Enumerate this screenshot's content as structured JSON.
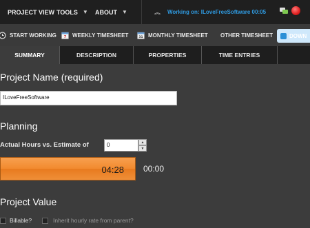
{
  "menu": {
    "items": [
      "PROJECT VIEW",
      "TOOLS",
      "ABOUT"
    ]
  },
  "working": {
    "label": "Working on: ILoveFreeSoftware 00:05"
  },
  "toolbar": {
    "start_working": "START WORKING",
    "weekly_timesheet": "WEEKLY TIMESHEET",
    "monthly_timesheet": "MONTHLY TIMESHEET",
    "other_timesheet": "OTHER TIMESHEET",
    "download": "DOWN"
  },
  "tabs": [
    "SUMMARY",
    "DESCRIPTION",
    "PROPERTIES",
    "TIME ENTRIES"
  ],
  "summary": {
    "project_name_heading": "Project Name (required)",
    "project_name_value": "ILoveFreeSoftware",
    "planning_heading": "Planning",
    "estimate_label": "Actual Hours vs. Estimate of",
    "estimate_value": "0",
    "progress_time": "04:28",
    "estimate_time": "00:00",
    "project_value_heading": "Project Value",
    "billable_label": "Billable?",
    "inherit_label": "Inherit hourly rate from parent?"
  },
  "colors": {
    "accent": "#2f9ae0",
    "progress": "#f28a2e",
    "background": "#3c3c3c"
  }
}
